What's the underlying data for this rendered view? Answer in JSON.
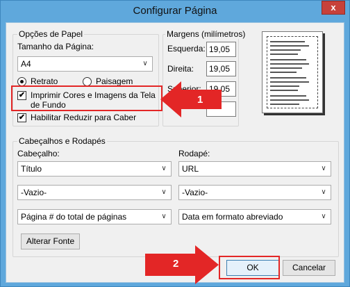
{
  "window": {
    "title": "Configurar Página",
    "close_label": "x"
  },
  "paper": {
    "group_label": "Opções de Papel",
    "size_label": "Tamanho da Página:",
    "size_value": "A4",
    "orientation": {
      "portrait_label": "Retrato",
      "landscape_label": "Paisagem",
      "selected": "Retrato"
    },
    "print_bg_label": "Imprimir Cores e Imagens da Tela de Fundo",
    "print_bg_checked": true,
    "shrink_label": "Habilitar Reduzir para Caber",
    "shrink_checked": true
  },
  "margins": {
    "group_label": "Margens (milímetros)",
    "left_label": "Esquerda:",
    "left_value": "19,05",
    "right_label": "Direita:",
    "right_value": "19,05",
    "top_label": "Superior:",
    "top_value": "19,05",
    "bottom_value": ""
  },
  "headers": {
    "group_label": "Cabeçalhos e Rodapés",
    "header_label": "Cabeçalho:",
    "footer_label": "Rodapé:",
    "header_rows": [
      "Título",
      "-Vazio-",
      "Página # do total de páginas"
    ],
    "footer_rows": [
      "URL",
      "-Vazio-",
      "Data em formato abreviado"
    ],
    "change_font_label": "Alterar Fonte"
  },
  "buttons": {
    "ok_label": "OK",
    "cancel_label": "Cancelar"
  },
  "annotations": {
    "step1": "1",
    "step2": "2",
    "highlight_color": "#e32626"
  }
}
